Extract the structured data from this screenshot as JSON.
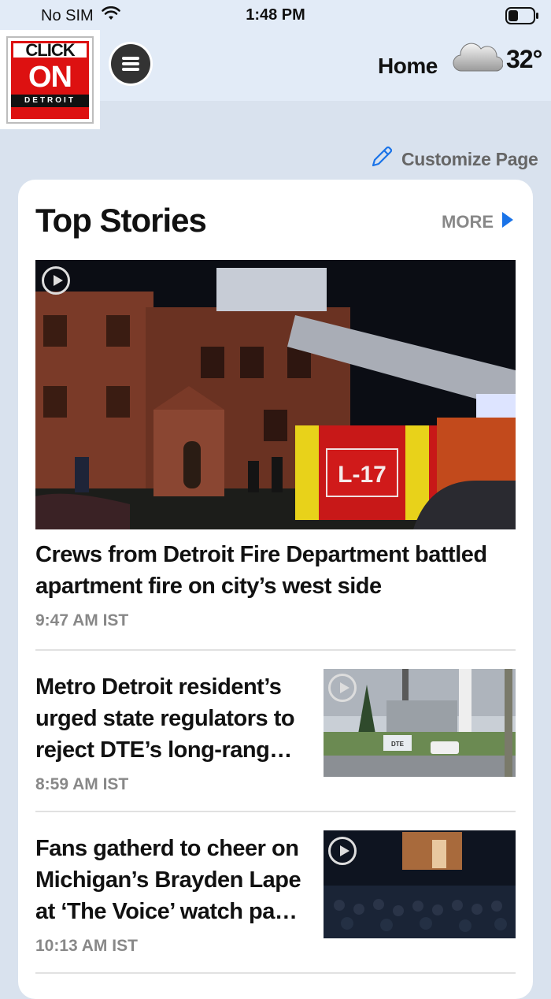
{
  "status_bar": {
    "carrier": "No SIM",
    "time": "1:48 PM"
  },
  "header": {
    "logo": {
      "line1": "CLICK",
      "line2": "ON",
      "line3": "DETROIT"
    },
    "nav_label": "Home",
    "temperature": "32°",
    "weather_icon": "cloud-icon"
  },
  "customize_label": "Customize Page",
  "section": {
    "title": "Top Stories",
    "more_label": "MORE",
    "hero": {
      "headline": "Crews from Detroit Fire Department battled apartment fire on city’s west side",
      "time": "9:47 AM IST",
      "truck_label": "L-17"
    },
    "stories": [
      {
        "headline": "Metro Detroit resident’s urged state regulators to reject DTE’s long-rang…",
        "time": "8:59 AM IST",
        "thumb_sign": "DTE"
      },
      {
        "headline": "Fans gatherd to cheer on Michigan’s Brayden Lape at ‘The Voice’ watch pa…",
        "time": "10:13 AM IST"
      }
    ]
  },
  "colors": {
    "accent": "#1a73e8",
    "brand_red": "#d11111",
    "page_bg": "#d9e2ee"
  }
}
